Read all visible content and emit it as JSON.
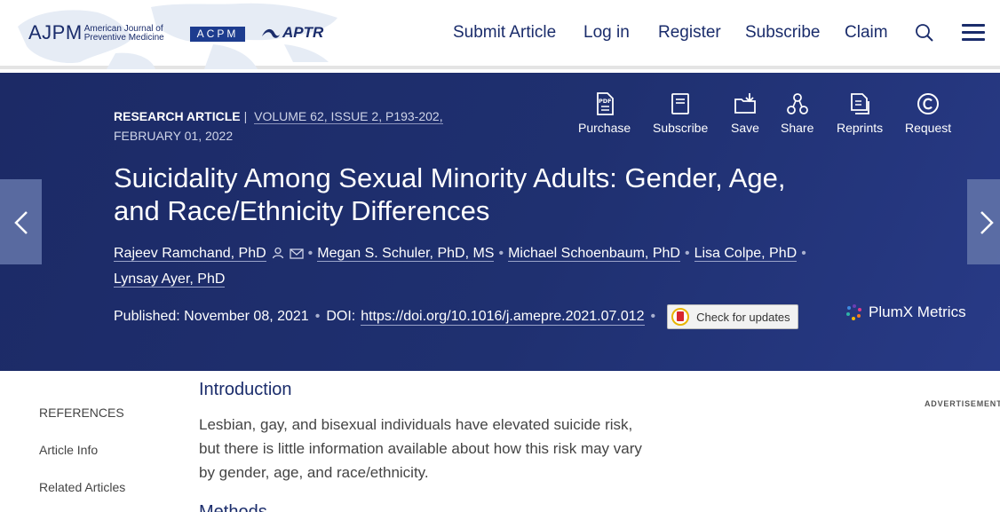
{
  "header": {
    "logo": {
      "abbr": "AJPM",
      "line1": "American Journal of",
      "line2": "Preventive Medicine"
    },
    "partner1": "ACPM",
    "partner2": "APTR",
    "nav": [
      {
        "label": "Submit Article"
      },
      {
        "label": "Log in"
      },
      {
        "label": "Register"
      },
      {
        "label": "Subscribe"
      },
      {
        "label": "Claim"
      }
    ],
    "icons": {
      "search": "search-icon",
      "menu": "hamburger-menu-icon"
    }
  },
  "article": {
    "type": "RESEARCH ARTICLE",
    "volume": "VOLUME 62, ISSUE 2, P193-202,",
    "date": "FEBRUARY 01, 2022",
    "title": "Suicidality Among Sexual Minority Adults: Gender, Age, and Race/Ethnicity Differences",
    "authors": [
      {
        "name": "Rajeev Ramchand, PhD"
      },
      {
        "name": "Megan S. Schuler, PhD, MS"
      },
      {
        "name": "Michael Schoenbaum, PhD"
      },
      {
        "name": "Lisa Colpe, PhD"
      },
      {
        "name": "Lynsay Ayer, PhD"
      }
    ],
    "published_label": "Published:",
    "published_date": "November 08, 2021",
    "doi_label": "DOI:",
    "doi": "https://doi.org/10.1016/j.amepre.2021.07.012",
    "check_updates": "Check for updates",
    "plumx": "PlumX Metrics"
  },
  "actions": [
    {
      "label": "Purchase",
      "icon": "pdf-icon"
    },
    {
      "label": "Subscribe",
      "icon": "journal-icon"
    },
    {
      "label": "Save",
      "icon": "save-folder-icon"
    },
    {
      "label": "Share",
      "icon": "share-icon"
    },
    {
      "label": "Reprints",
      "icon": "reprints-icon"
    },
    {
      "label": "Request",
      "icon": "copyright-icon"
    }
  ],
  "sidenav": [
    {
      "label": "REFERENCES"
    },
    {
      "label": "Article Info"
    },
    {
      "label": "Related Articles"
    }
  ],
  "content": {
    "heading": "Introduction",
    "paragraph": "Lesbian, gay, and bisexual individuals have elevated suicide risk, but there is little information available about how this risk may vary by gender, age, and race/ethnicity.",
    "next_heading": "Methods"
  },
  "advertisement_label": "ADVERTISEMENT",
  "colors": {
    "brand_navy": "#1a2c6b",
    "hero_bg": "#1f3070"
  }
}
